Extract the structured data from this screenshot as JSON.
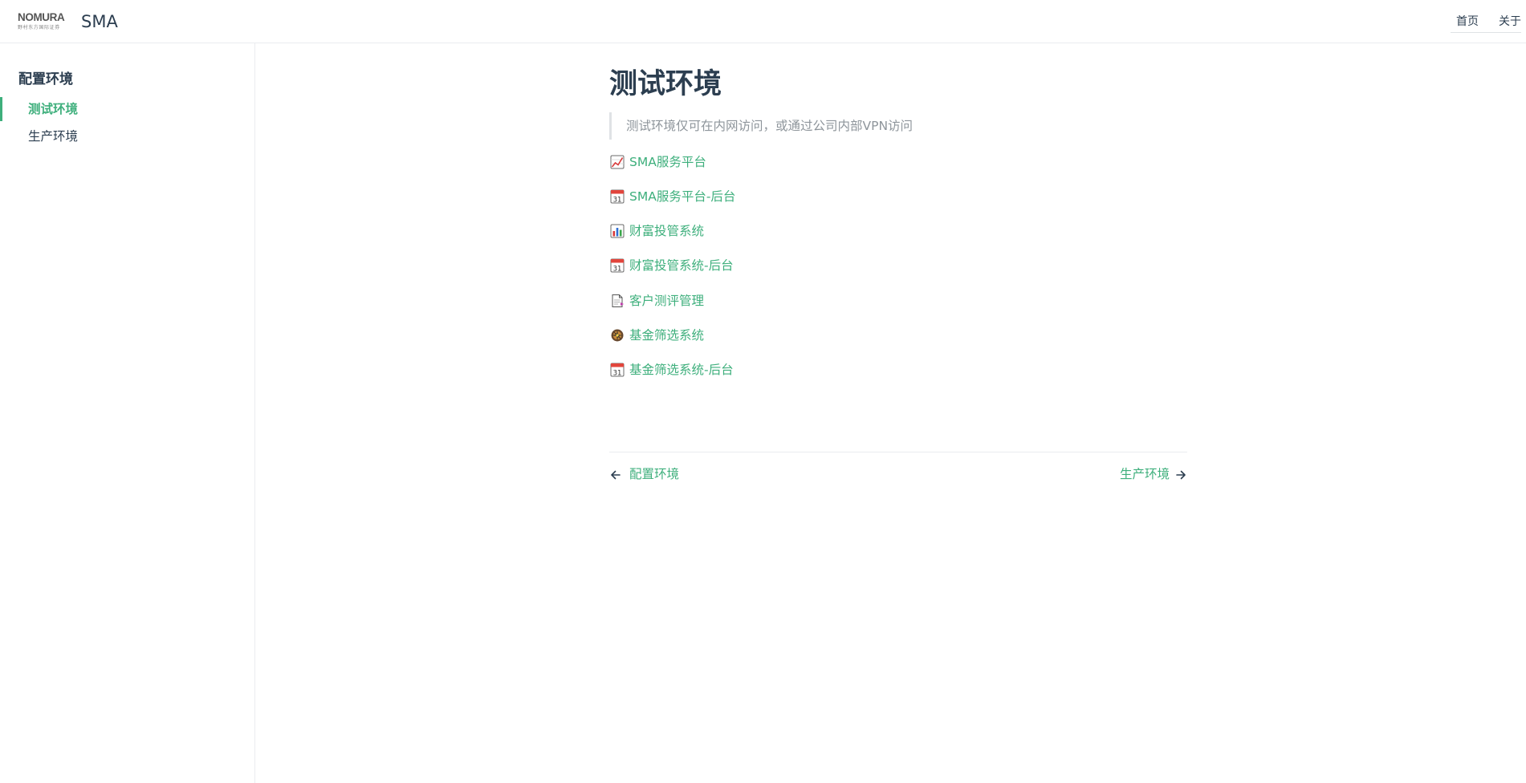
{
  "header": {
    "logo_word": "NOMURA",
    "logo_sub": "野村东方国际证券",
    "site_title": "SMA",
    "nav": [
      {
        "label": "首页"
      },
      {
        "label": "关于"
      }
    ]
  },
  "sidebar": {
    "heading": "配置环境",
    "items": [
      {
        "label": "测试环境",
        "active": true
      },
      {
        "label": "生产环境",
        "active": false
      }
    ]
  },
  "main": {
    "title": "测试环境",
    "note": "测试环境仅可在内网访问，或通过公司内部VPN访问",
    "links": [
      {
        "icon": "chart-increasing-icon",
        "label": "SMA服务平台"
      },
      {
        "icon": "calendar-icon",
        "label": "SMA服务平台-后台"
      },
      {
        "icon": "bar-chart-icon",
        "label": "财富投管系统"
      },
      {
        "icon": "calendar-icon",
        "label": "财富投管系统-后台"
      },
      {
        "icon": "document-icon",
        "label": "客户测评管理"
      },
      {
        "icon": "filter-wheel-icon",
        "label": "基金筛选系统"
      },
      {
        "icon": "calendar-icon",
        "label": "基金筛选系统-后台"
      }
    ],
    "calendar_day": "31",
    "prev": {
      "label": "配置环境"
    },
    "next": {
      "label": "生产环境"
    }
  },
  "colors": {
    "accent": "#3eaf7c",
    "text": "#2c3e50",
    "muted": "#8e959b",
    "border": "#eaecef"
  }
}
